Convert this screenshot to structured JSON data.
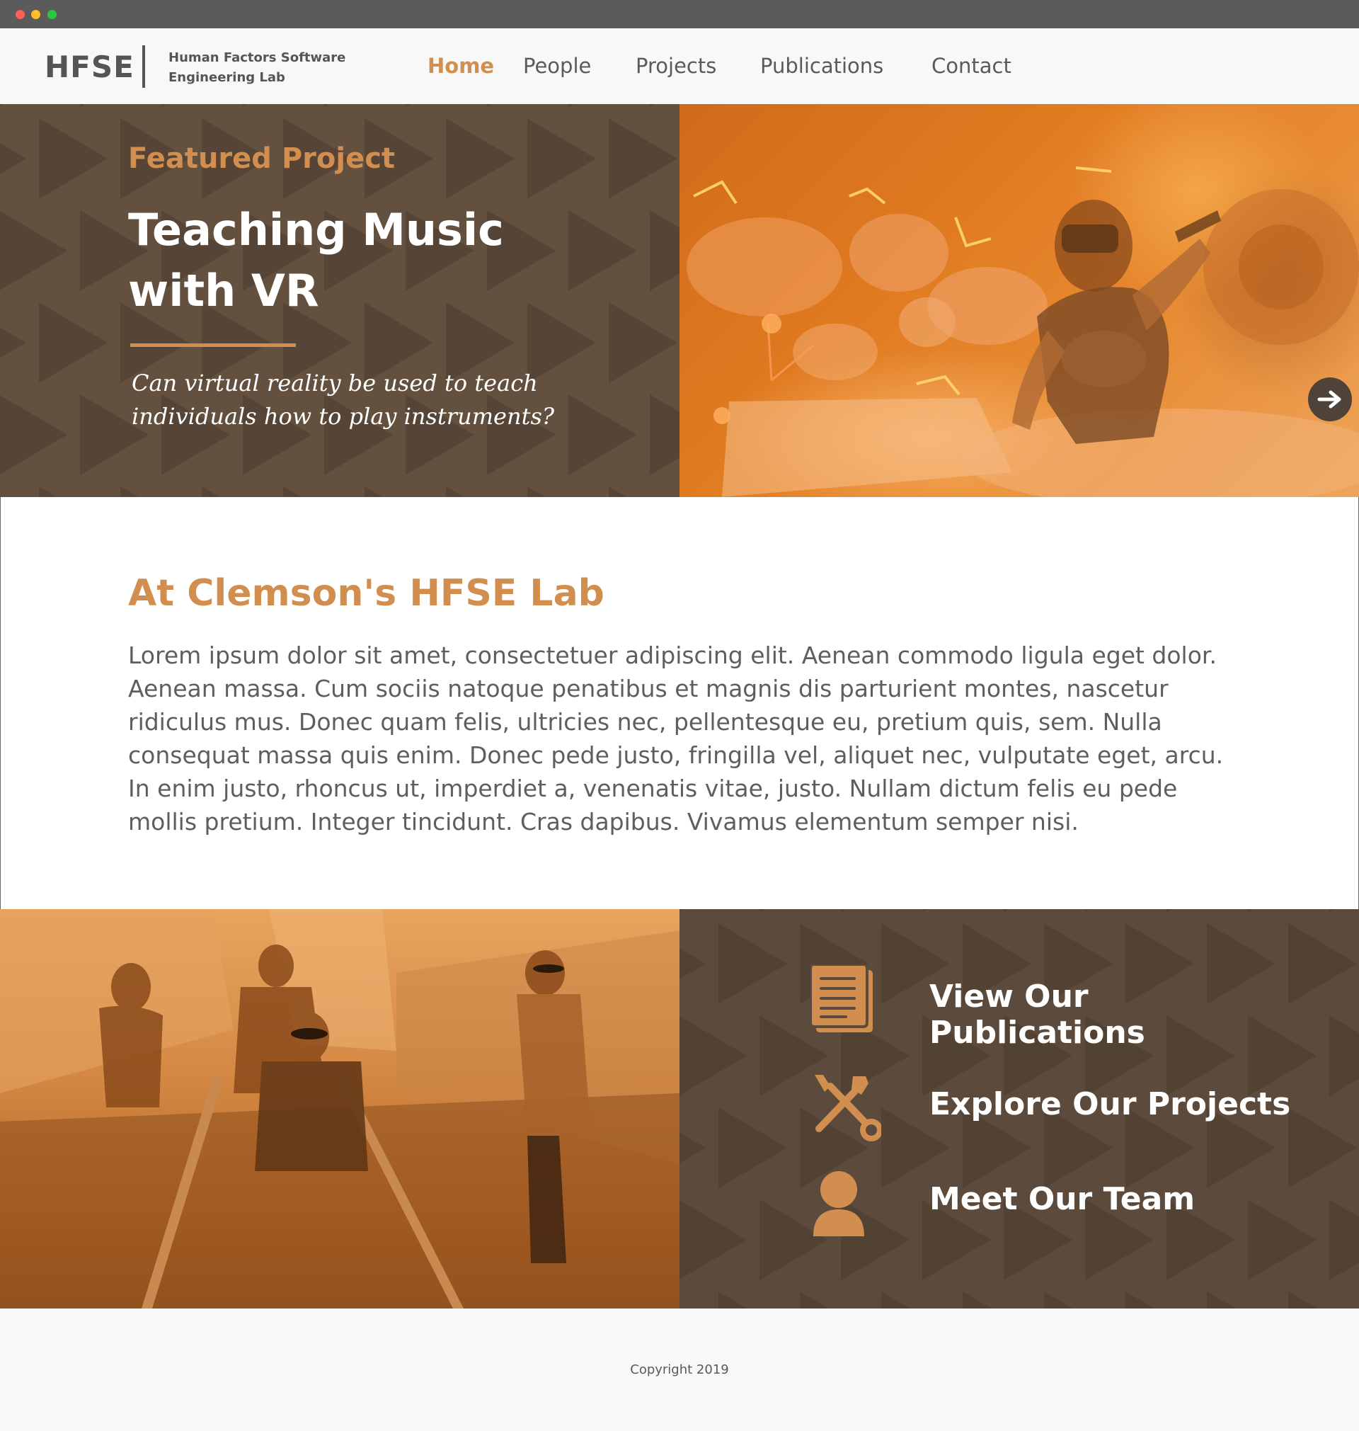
{
  "header": {
    "logo": "HFSE",
    "logo_subtitle": "Human Factors Software Engineering Lab",
    "nav": [
      {
        "label": "Home",
        "active": true
      },
      {
        "label": "People",
        "active": false
      },
      {
        "label": "Projects",
        "active": false
      },
      {
        "label": "Publications",
        "active": false
      },
      {
        "label": "Contact",
        "active": false
      }
    ]
  },
  "hero": {
    "eyebrow": "Featured Project",
    "title": "Teaching Music with VR",
    "description": "Can virtual reality be used to teach individuals how to play instruments?",
    "next_icon": "arrow-right-icon"
  },
  "about": {
    "title": "At Clemson's HFSE Lab",
    "body": "Lorem ipsum dolor sit amet, consectetuer adipiscing elit. Aenean commodo ligula eget dolor. Aenean massa. Cum sociis natoque penatibus et magnis dis parturient montes, nascetur ridiculus mus. Donec quam felis, ultricies nec, pellentesque eu, pretium quis, sem. Nulla consequat massa quis enim. Donec pede justo, fringilla vel, aliquet nec, vulputate eget, arcu. In enim justo, rhoncus ut, imperdiet a, venenatis vitae, justo. Nullam dictum felis eu pede mollis pretium. Integer tincidunt. Cras dapibus. Vivamus elementum semper nisi."
  },
  "links": [
    {
      "label": "View Our Publications",
      "icon": "document-icon"
    },
    {
      "label": "Explore Our Projects",
      "icon": "tools-icon"
    },
    {
      "label": "Meet Our Team",
      "icon": "person-icon"
    }
  ],
  "footer": {
    "copyright": "Copyright 2019"
  },
  "colors": {
    "accent": "#d18e4e",
    "dark_panel": "#63503f",
    "text_gray": "#5e5e5e"
  }
}
